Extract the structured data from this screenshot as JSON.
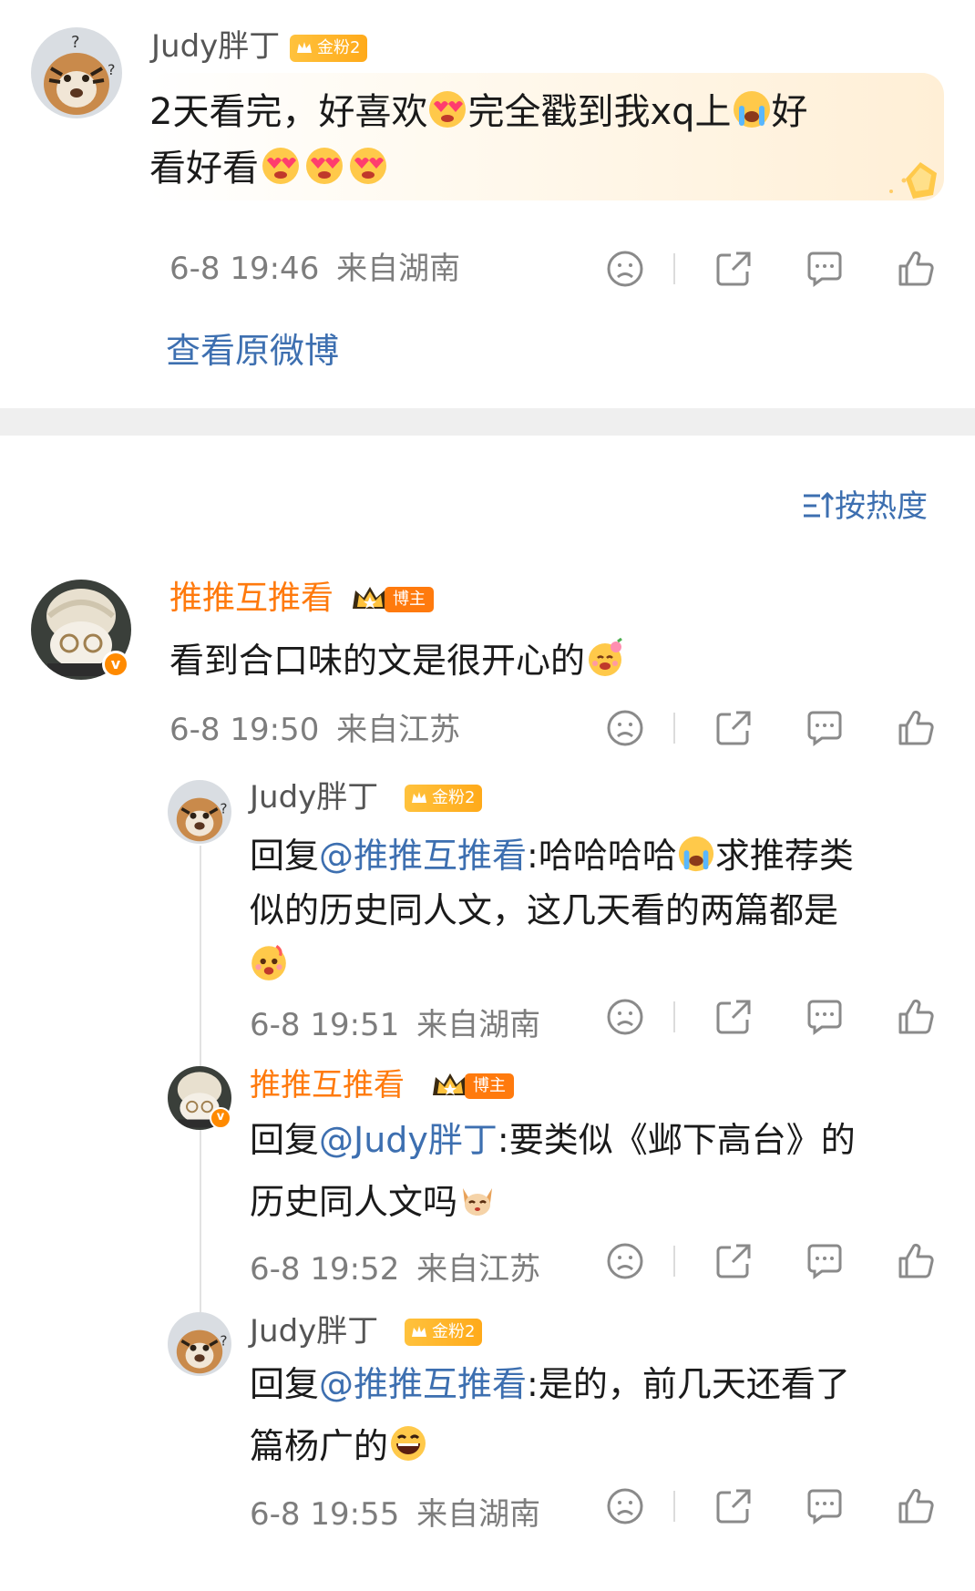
{
  "original_post": {
    "user": "Judy胖丁",
    "fan_badge": "金粉2",
    "line1": "2天看完，好喜欢",
    "line1b": "完全戳到我xq上",
    "line1c": "好",
    "line2": "看好看",
    "time": "6-8 19:46",
    "location": "来自湖南",
    "view_original": "查看原微博"
  },
  "sort": {
    "label": "按热度"
  },
  "comments": [
    {
      "user": "推推互推看",
      "host_badge": "博主",
      "text": "看到合口味的文是很开心的",
      "time": "6-8 19:50",
      "location": "来自江苏"
    },
    {
      "user": "Judy胖丁",
      "fan_badge": "金粉2",
      "reply_prefix": "回复",
      "mention": "@推推互推看",
      "text1": ":哈哈哈哈",
      "text1b": "求推荐类",
      "text2": "似的历史同人文，这几天看的两篇都是",
      "time": "6-8 19:51",
      "location": "来自湖南"
    },
    {
      "user": "推推互推看",
      "host_badge": "博主",
      "reply_prefix": "回复",
      "mention": "@Judy胖丁",
      "text1": ":要类似《邺下高台》的",
      "text2": "历史同人文吗",
      "time": "6-8 19:52",
      "location": "来自江苏"
    },
    {
      "user": "Judy胖丁",
      "fan_badge": "金粉2",
      "reply_prefix": "回复",
      "mention": "@推推互推看",
      "text1": ":是的，前几天还看了",
      "text2": "篇杨广的",
      "time": "6-8 19:55",
      "location": "来自湖南"
    }
  ],
  "icons": {
    "dislike": "sad-face-icon",
    "share": "share-icon",
    "comment": "comment-icon",
    "like": "thumbs-up-icon"
  },
  "colors": {
    "accent_orange": "#ff7a0d",
    "mention_blue": "#3d6fb0",
    "gold": "#ffb020",
    "divider": "#efefef"
  }
}
